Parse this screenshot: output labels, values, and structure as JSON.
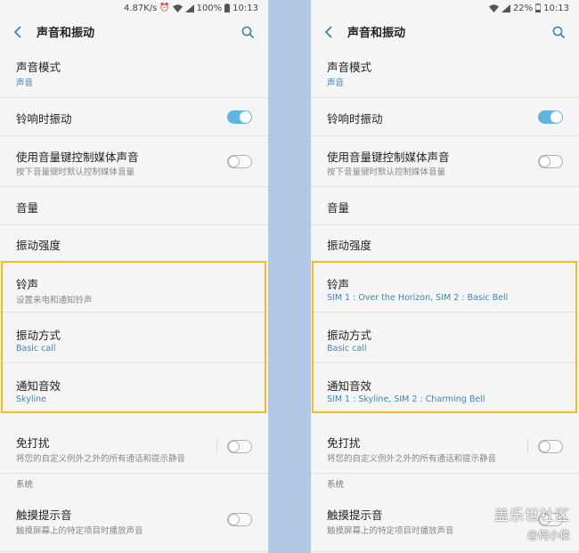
{
  "left": {
    "status": {
      "speed": "4.87K/s",
      "battery": "100%",
      "time": "10:13"
    },
    "app_bar": {
      "title": "声音和振动"
    },
    "items": {
      "sound_mode": {
        "title": "声音模式",
        "subtitle": "声音"
      },
      "vibrate_when_ringing": {
        "title": "铃响时振动",
        "toggle": "on"
      },
      "volume_keys_media": {
        "title": "使用音量键控制媒体声音",
        "subtitle": "按下音量键时默认控制媒体音量",
        "toggle": "off"
      },
      "volume": {
        "title": "音量"
      },
      "vibration_intensity": {
        "title": "振动强度"
      },
      "ringtone": {
        "title": "铃声",
        "subtitle": "设置来电和通知铃声"
      },
      "vibration_pattern": {
        "title": "振动方式",
        "subtitle": "Basic call"
      },
      "notification_sound": {
        "title": "通知音效",
        "subtitle": "Skyline"
      },
      "do_not_disturb": {
        "title": "免打扰",
        "subtitle": "将您的自定义例外之外的所有通话和提示静音",
        "toggle": "off"
      },
      "system_label": "系统",
      "touch_sounds": {
        "title": "触摸提示音",
        "subtitle": "触摸屏幕上的特定项目时播放声音",
        "toggle": "off"
      }
    }
  },
  "right": {
    "status": {
      "battery": "22%",
      "time": "10:13"
    },
    "app_bar": {
      "title": "声音和振动"
    },
    "items": {
      "sound_mode": {
        "title": "声音模式",
        "subtitle": "声音"
      },
      "vibrate_when_ringing": {
        "title": "铃响时振动",
        "toggle": "on"
      },
      "volume_keys_media": {
        "title": "使用音量键控制媒体声音",
        "subtitle": "按下音量键时默认控制媒体音量",
        "toggle": "off"
      },
      "volume": {
        "title": "音量"
      },
      "vibration_intensity": {
        "title": "振动强度"
      },
      "ringtone": {
        "title": "铃声",
        "subtitle": "SIM 1 : Over the Horizon, SIM 2 : Basic Bell"
      },
      "vibration_pattern": {
        "title": "振动方式",
        "subtitle": "Basic call"
      },
      "notification_sound": {
        "title": "通知音效",
        "subtitle": "SIM 1 : Skyline, SIM 2 : Charming Bell"
      },
      "do_not_disturb": {
        "title": "免打扰",
        "subtitle": "将您的自定义例外之外的所有通话和提示静音",
        "toggle": "off"
      },
      "system_label": "系统",
      "touch_sounds": {
        "title": "触摸提示音",
        "subtitle": "触摸屏幕上的特定项目时播放声音",
        "toggle": "off"
      }
    }
  },
  "watermark": {
    "title": "盖乐世社区",
    "author": "@何小俊"
  },
  "colors": {
    "accent": "#3d86b8",
    "toggle_on": "#5fb4e0",
    "highlight": "#f2be1c",
    "divider_strip": "#b3c8e6"
  },
  "icons": [
    "back-arrow-icon",
    "search-icon",
    "wifi-icon",
    "signal-icon",
    "battery-icon",
    "alarm-icon"
  ]
}
